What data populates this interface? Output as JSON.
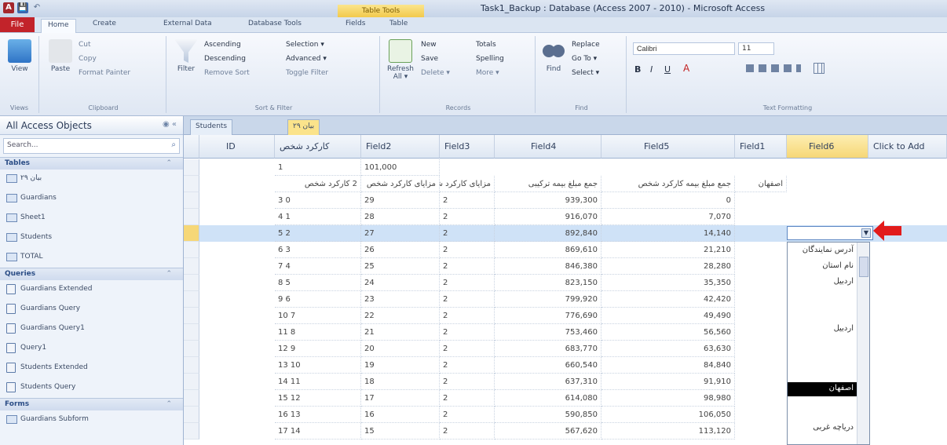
{
  "window": {
    "title": "Task1_Backup : Database (Access 2007 - 2010) - Microsoft Access",
    "context_tab": "Table Tools",
    "qat": [
      "A",
      "💾",
      "↶"
    ]
  },
  "ribbon_tabs": [
    "File",
    "Home",
    "Create",
    "External Data",
    "Database Tools",
    "Fields",
    "Table"
  ],
  "ribbon": {
    "views": {
      "label": "Views",
      "view": "View"
    },
    "clipboard": {
      "label": "Clipboard",
      "paste": "Paste",
      "cut": "Cut",
      "copy": "Copy",
      "format_painter": "Format Painter"
    },
    "sort_filter": {
      "label": "Sort & Filter",
      "filter": "Filter",
      "ascending": "Ascending",
      "descending": "Descending",
      "remove_sort": "Remove Sort",
      "selection": "Selection ▾",
      "advanced": "Advanced ▾",
      "toggle_filter": "Toggle Filter"
    },
    "records": {
      "label": "Records",
      "refresh": "Refresh All ▾",
      "new": "New",
      "save": "Save",
      "delete": "Delete ▾",
      "totals": "Totals",
      "spelling": "Spelling",
      "more": "More ▾"
    },
    "find": {
      "label": "Find",
      "find": "Find",
      "replace": "Replace",
      "goto": "Go To ▾",
      "select": "Select ▾"
    },
    "text_format": {
      "label": "Text Formatting",
      "font": "Calibri",
      "size": "11"
    }
  },
  "nav": {
    "header": "All Access Objects",
    "search_placeholder": "Search...",
    "sections": [
      {
        "name": "Tables",
        "items": [
          "بیان ۲۹",
          "Guardians",
          "Sheet1",
          "Students",
          "TOTAL"
        ]
      },
      {
        "name": "Queries",
        "items": [
          "Guardians Extended",
          "Guardians Query",
          "Guardians Query1",
          "Query1",
          "Students Extended",
          "Students Query"
        ]
      },
      {
        "name": "Forms",
        "items": [
          "Guardians Subform"
        ]
      }
    ]
  },
  "doc_tabs": [
    "Students",
    "بیان ۲۹"
  ],
  "grid": {
    "columns": [
      "ID",
      "کارکرد شخص",
      "Field2",
      "Field3",
      "Field4",
      "Field5",
      "Field1",
      "Field6",
      "Click to Add"
    ],
    "rows": [
      [
        "",
        "1",
        "101,000",
        "",
        "",
        "",
        "",
        ""
      ],
      [
        "",
        "2 کارکرد شخص",
        "مزایای کارکرد شخص",
        "مزایای کارکرد شخص",
        "جمع مبلغ بیمه ترکیبی",
        "جمع مبلغ بیمه کارکرد شخص",
        "اصفهان",
        ""
      ],
      [
        "",
        "3 0",
        "29",
        "2",
        "939,300",
        "0",
        "",
        ""
      ],
      [
        "",
        "4 1",
        "28",
        "2",
        "916,070",
        "7,070",
        "",
        ""
      ],
      [
        "",
        "5 2",
        "27",
        "2",
        "892,840",
        "14,140",
        "",
        ""
      ],
      [
        "",
        "6 3",
        "26",
        "2",
        "869,610",
        "21,210",
        "",
        ""
      ],
      [
        "",
        "7 4",
        "25",
        "2",
        "846,380",
        "28,280",
        "",
        ""
      ],
      [
        "",
        "8 5",
        "24",
        "2",
        "823,150",
        "35,350",
        "",
        ""
      ],
      [
        "",
        "9 6",
        "23",
        "2",
        "799,920",
        "42,420",
        "",
        ""
      ],
      [
        "",
        "10 7",
        "22",
        "2",
        "776,690",
        "49,490",
        "",
        ""
      ],
      [
        "",
        "11 8",
        "21",
        "2",
        "753,460",
        "56,560",
        "",
        ""
      ],
      [
        "",
        "12 9",
        "20",
        "2",
        "683,770",
        "63,630",
        "",
        ""
      ],
      [
        "",
        "13 10",
        "19",
        "2",
        "660,540",
        "84,840",
        "",
        ""
      ],
      [
        "",
        "14 11",
        "18",
        "2",
        "637,310",
        "91,910",
        "",
        ""
      ],
      [
        "",
        "15 12",
        "17",
        "2",
        "614,080",
        "98,980",
        "",
        ""
      ],
      [
        "",
        "16 13",
        "16",
        "2",
        "590,850",
        "106,050",
        "",
        ""
      ],
      [
        "",
        "17 14",
        "15",
        "2",
        "567,620",
        "113,120",
        "",
        ""
      ]
    ],
    "current_row": 4
  },
  "dropdown": {
    "options": [
      "آدرس نمایندگان",
      "نام استان",
      "اردبیل",
      "اردبیل",
      "اصفهان",
      "دریاچه غربی"
    ],
    "highlighted": 4
  },
  "colors": {
    "accent": "#c2232a",
    "highlight_row": "#cfe2f7",
    "selected_header": "#f6d777",
    "arrow": "#e21b1b"
  }
}
